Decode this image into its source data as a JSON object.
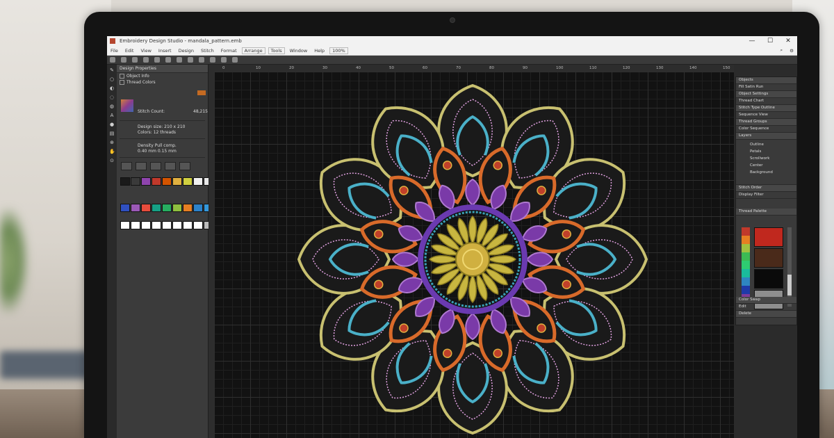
{
  "window": {
    "title": "Embroidery Design Studio - mandala_pattern.emb",
    "minimize": "—",
    "maximize": "☐",
    "close": "✕"
  },
  "menu": {
    "items": [
      "File",
      "Edit",
      "View",
      "Insert",
      "Design",
      "Stitch",
      "Format",
      "Arrange"
    ],
    "extra": [
      "Tools",
      "Window",
      "Help"
    ],
    "zoom": "100%"
  },
  "left_panel": {
    "header": "Design Properties",
    "row1": "Object Info",
    "row2": "Thread Colors",
    "stitch_label": "Stitch Count:",
    "stitch_value": "48,215",
    "info1": "Design size: 210 x 210",
    "info2": "Colors: 12 threads",
    "settings1": "Density  Pull comp.",
    "settings2": "0.40 mm  0.15 mm"
  },
  "ruler": {
    "labels": [
      "0",
      "10",
      "20",
      "30",
      "40",
      "50",
      "60",
      "70",
      "80",
      "90",
      "100",
      "110",
      "120",
      "130",
      "140",
      "150"
    ]
  },
  "right_panel": {
    "rows": [
      "Objects",
      "Fill   Satin   Run",
      "Object Settings",
      "Thread Chart",
      "Stitch Type Outline",
      "Sequence View",
      "Thread Groups",
      "Color Sequence"
    ],
    "tree_header": "Layers",
    "tree": [
      "Outline",
      "Petals",
      "Scrollwork",
      "Center",
      "Background"
    ],
    "row_after_tree": "Stitch Order",
    "row_after_tree2": "Display Filter",
    "palette_header": "Thread Palette",
    "bottom_rows": [
      "Color Swap",
      "Edit",
      "Delete"
    ]
  },
  "colors": {
    "palette_strip": [
      "#c0392b",
      "#e67e22",
      "#a0c040",
      "#3cba54",
      "#2ecc71",
      "#1abc9c",
      "#2e86c1",
      "#1f3aa8",
      "#7d3c98"
    ],
    "palette_big": [
      "#c0281e",
      "#4a2a1a",
      "#0a0a0a",
      "#8e8e8e"
    ],
    "swatches_row1": [
      "#1a1a1a",
      "#3a3a3a",
      "#8e44ad",
      "#c0392b",
      "#d35400",
      "#e0b040",
      "#d0d040",
      "#f0f0f0",
      "#e8e8e8"
    ],
    "swatches_row2": [
      "#3050c0",
      "#9b59b6",
      "#e74c3c",
      "#16a085",
      "#27ae60",
      "#8fbf3f",
      "#e67e22",
      "#2c82c9",
      "#3498db"
    ],
    "swatches_row3": [
      "#ffffff",
      "#ffffff",
      "#ffffff",
      "#ffffff",
      "#ffffff",
      "#ffffff",
      "#ffffff",
      "#ffffff",
      "#bbbbbb"
    ]
  }
}
